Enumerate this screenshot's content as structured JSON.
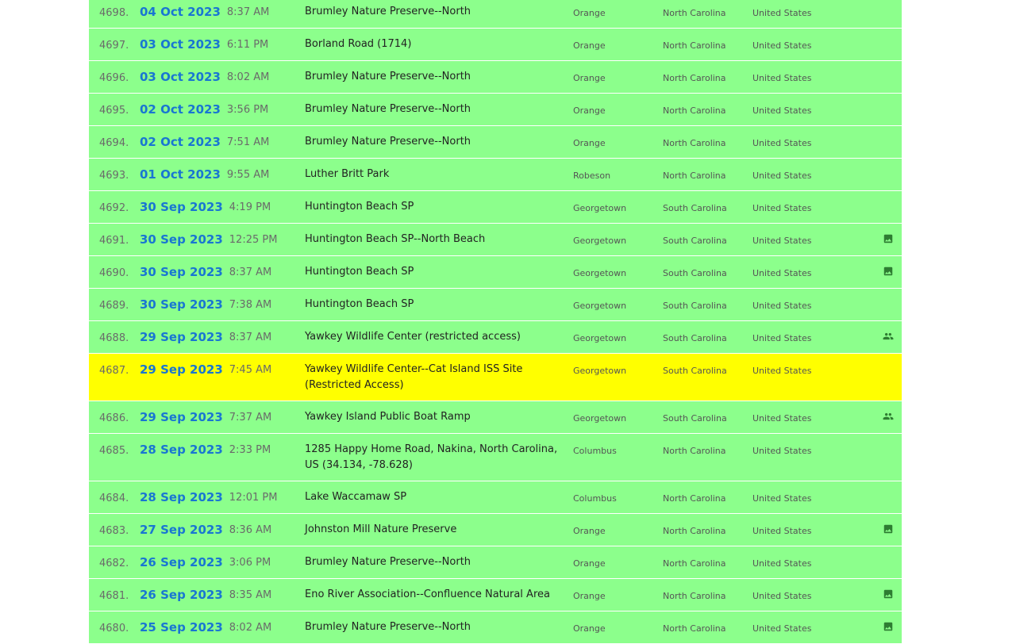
{
  "checklists": [
    {
      "num": "4698.",
      "date": "04 Oct 2023",
      "time": "8:37 AM",
      "location": "Brumley Nature Preserve--North",
      "county": "Orange",
      "state": "North Carolina",
      "country": "United States",
      "icon": ""
    },
    {
      "num": "4697.",
      "date": "03 Oct 2023",
      "time": "6:11 PM",
      "location": "Borland Road (1714)",
      "county": "Orange",
      "state": "North Carolina",
      "country": "United States",
      "icon": ""
    },
    {
      "num": "4696.",
      "date": "03 Oct 2023",
      "time": "8:02 AM",
      "location": "Brumley Nature Preserve--North",
      "county": "Orange",
      "state": "North Carolina",
      "country": "United States",
      "icon": ""
    },
    {
      "num": "4695.",
      "date": "02 Oct 2023",
      "time": "3:56 PM",
      "location": "Brumley Nature Preserve--North",
      "county": "Orange",
      "state": "North Carolina",
      "country": "United States",
      "icon": ""
    },
    {
      "num": "4694.",
      "date": "02 Oct 2023",
      "time": "7:51 AM",
      "location": "Brumley Nature Preserve--North",
      "county": "Orange",
      "state": "North Carolina",
      "country": "United States",
      "icon": ""
    },
    {
      "num": "4693.",
      "date": "01 Oct 2023",
      "time": "9:55 AM",
      "location": "Luther Britt Park",
      "county": "Robeson",
      "state": "North Carolina",
      "country": "United States",
      "icon": ""
    },
    {
      "num": "4692.",
      "date": "30 Sep 2023",
      "time": "4:19 PM",
      "location": "Huntington Beach SP",
      "county": "Georgetown",
      "state": "South Carolina",
      "country": "United States",
      "icon": ""
    },
    {
      "num": "4691.",
      "date": "30 Sep 2023",
      "time": "12:25 PM",
      "location": "Huntington Beach SP--North Beach",
      "county": "Georgetown",
      "state": "South Carolina",
      "country": "United States",
      "icon": "photo-icon"
    },
    {
      "num": "4690.",
      "date": "30 Sep 2023",
      "time": "8:37 AM",
      "location": "Huntington Beach SP",
      "county": "Georgetown",
      "state": "South Carolina",
      "country": "United States",
      "icon": "photo-icon"
    },
    {
      "num": "4689.",
      "date": "30 Sep 2023",
      "time": "7:38 AM",
      "location": "Huntington Beach SP",
      "county": "Georgetown",
      "state": "South Carolina",
      "country": "United States",
      "icon": ""
    },
    {
      "num": "4688.",
      "date": "29 Sep 2023",
      "time": "8:37 AM",
      "location": "Yawkey Wildlife Center (restricted access)",
      "county": "Georgetown",
      "state": "South Carolina",
      "country": "United States",
      "icon": "group-icon"
    },
    {
      "num": "4687.",
      "date": "29 Sep 2023",
      "time": "7:45 AM",
      "location": "Yawkey Wildlife Center--Cat Island ISS Site (Restricted Access)",
      "county": "Georgetown",
      "state": "South Carolina",
      "country": "United States",
      "icon": "",
      "highlight": true,
      "tall": true
    },
    {
      "num": "4686.",
      "date": "29 Sep 2023",
      "time": "7:37 AM",
      "location": "Yawkey Island Public Boat Ramp",
      "county": "Georgetown",
      "state": "South Carolina",
      "country": "United States",
      "icon": "group-icon"
    },
    {
      "num": "4685.",
      "date": "28 Sep 2023",
      "time": "2:33 PM",
      "location": "1285 Happy Home Road, Nakina, North Carolina, US (34.134, -78.628)",
      "county": "Columbus",
      "state": "North Carolina",
      "country": "United States",
      "icon": "",
      "tall": true
    },
    {
      "num": "4684.",
      "date": "28 Sep 2023",
      "time": "12:01 PM",
      "location": "Lake Waccamaw SP",
      "county": "Columbus",
      "state": "North Carolina",
      "country": "United States",
      "icon": ""
    },
    {
      "num": "4683.",
      "date": "27 Sep 2023",
      "time": "8:36 AM",
      "location": "Johnston Mill Nature Preserve",
      "county": "Orange",
      "state": "North Carolina",
      "country": "United States",
      "icon": "photo-icon"
    },
    {
      "num": "4682.",
      "date": "26 Sep 2023",
      "time": "3:06 PM",
      "location": "Brumley Nature Preserve--North",
      "county": "Orange",
      "state": "North Carolina",
      "country": "United States",
      "icon": ""
    },
    {
      "num": "4681.",
      "date": "26 Sep 2023",
      "time": "8:35 AM",
      "location": "Eno River Association--Confluence Natural Area",
      "county": "Orange",
      "state": "North Carolina",
      "country": "United States",
      "icon": "photo-icon"
    },
    {
      "num": "4680.",
      "date": "25 Sep 2023",
      "time": "8:02 AM",
      "location": "Brumley Nature Preserve--North",
      "county": "Orange",
      "state": "North Carolina",
      "country": "United States",
      "icon": "photo-icon"
    }
  ]
}
